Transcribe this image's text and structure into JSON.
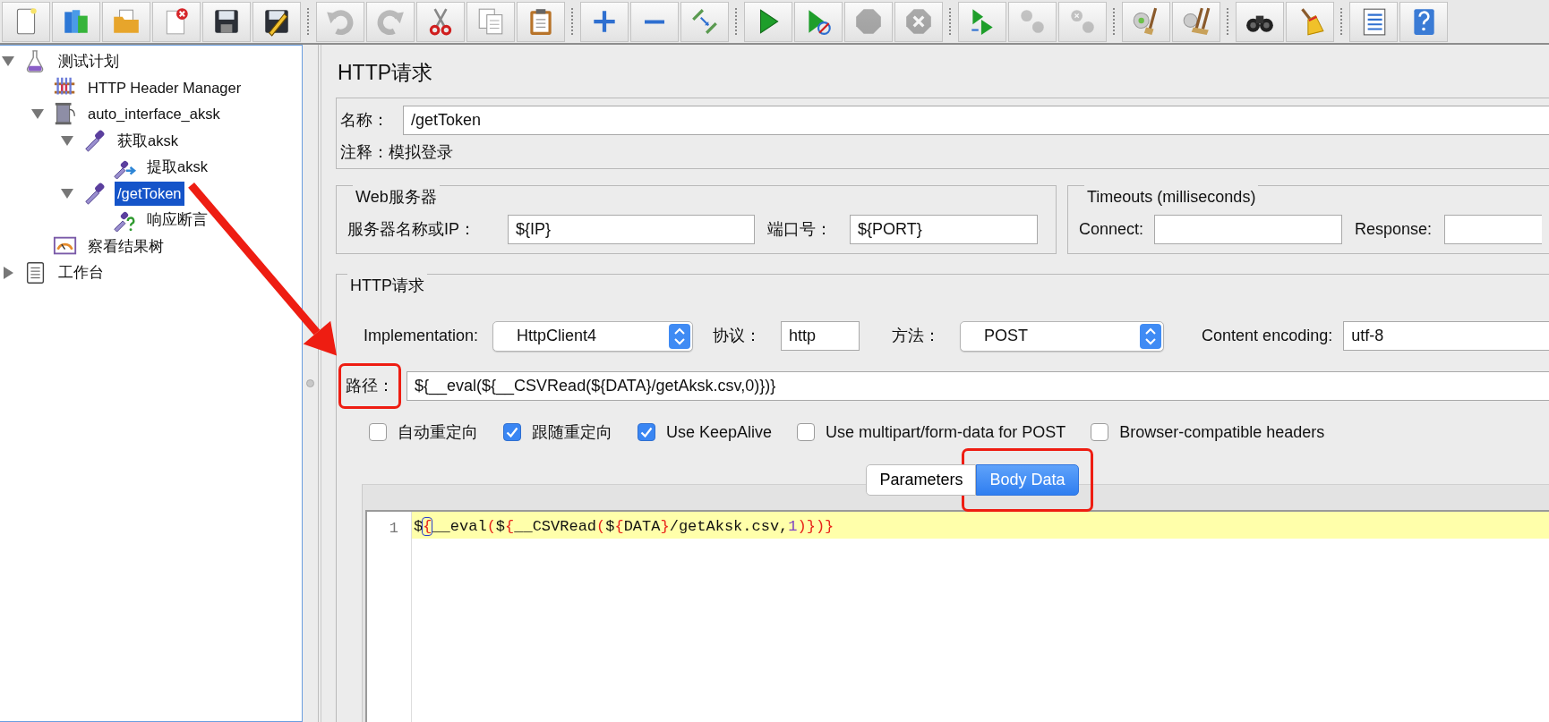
{
  "toolbar": {
    "groups": [
      [
        {
          "disabled": false
        },
        {
          "disabled": false
        },
        {
          "disabled": false
        },
        {
          "disabled": false
        },
        {
          "disabled": false
        },
        {
          "disabled": false
        }
      ],
      [
        {
          "disabled": true
        },
        {
          "disabled": true
        },
        {
          "disabled": false
        },
        {
          "disabled": false
        },
        {
          "disabled": false
        }
      ],
      [
        {
          "disabled": false
        },
        {
          "disabled": false
        },
        {
          "disabled": false
        }
      ],
      [
        {
          "disabled": false
        },
        {
          "disabled": false
        },
        {
          "disabled": true
        },
        {
          "disabled": true
        }
      ],
      [
        {
          "disabled": false
        },
        {
          "disabled": true
        },
        {
          "disabled": true
        }
      ],
      [
        {
          "disabled": false
        },
        {
          "disabled": false
        }
      ],
      [
        {
          "disabled": false
        },
        {
          "disabled": false
        }
      ],
      [
        {
          "disabled": false
        },
        {
          "disabled": false
        }
      ]
    ]
  },
  "tree": [
    {
      "label": "测试计划",
      "kind": "test-plan",
      "expanded": true,
      "selected": false,
      "children": [
        {
          "label": "HTTP Header Manager",
          "kind": "config-element",
          "selected": false
        },
        {
          "label": "auto_interface_aksk",
          "kind": "thread-group",
          "expanded": true,
          "selected": false,
          "children": [
            {
              "label": "获取aksk",
              "kind": "sampler",
              "expanded": true,
              "selected": false,
              "children": [
                {
                  "label": "提取aksk",
                  "kind": "post-processor",
                  "selected": false
                }
              ]
            },
            {
              "label": "/getToken",
              "kind": "sampler",
              "expanded": true,
              "selected": true,
              "children": [
                {
                  "label": "响应断言",
                  "kind": "assertion",
                  "selected": false
                }
              ]
            }
          ]
        },
        {
          "label": "察看结果树",
          "kind": "listener",
          "selected": false
        }
      ]
    },
    {
      "label": "工作台",
      "kind": "workbench",
      "expanded": false,
      "selected": false
    }
  ],
  "form": {
    "title": "HTTP请求",
    "name": {
      "label": "名称：",
      "value": "/getToken"
    },
    "comment": {
      "label": "注释：",
      "value": "模拟登录"
    },
    "web_server": {
      "legend": "Web服务器",
      "fields": [
        {
          "label": "服务器名称或IP：",
          "value": "${IP}"
        },
        {
          "label": "端口号：",
          "value": "${PORT}"
        }
      ]
    },
    "timeouts": {
      "legend": "Timeouts (milliseconds)",
      "fields": [
        {
          "label": "Connect:"
        },
        {
          "label": "Response:"
        }
      ]
    },
    "http_request": {
      "legend": "HTTP请求",
      "implementation": {
        "label": "Implementation:",
        "value": "HttpClient4"
      },
      "protocol": {
        "label": "协议：",
        "value": "http"
      },
      "method": {
        "label": "方法：",
        "value": "POST"
      },
      "content_encoding": {
        "label": "Content encoding:",
        "value": "utf-8"
      },
      "path": {
        "label": "路径：",
        "value": "${__eval(${__CSVRead(${DATA}/getAksk.csv,0)})}"
      },
      "options": [
        {
          "label": "自动重定向",
          "checked": false
        },
        {
          "label": "跟随重定向",
          "checked": true
        },
        {
          "label": "Use KeepAlive",
          "checked": true
        },
        {
          "label": "Use multipart/form-data for POST",
          "checked": false
        },
        {
          "label": "Browser-compatible headers",
          "checked": false
        }
      ],
      "tabs": [
        {
          "label": "Parameters",
          "selected": false
        },
        {
          "label": "Body Data",
          "selected": true
        }
      ],
      "body": {
        "lines": [
          {
            "number": "1",
            "current": true,
            "tokens": [
              {
                "text": "$",
                "kind": "plain"
              },
              {
                "text": "{",
                "kind": "brace-matched"
              },
              {
                "text": "__eval",
                "kind": "plain"
              },
              {
                "text": "(",
                "kind": "brace"
              },
              {
                "text": "$",
                "kind": "plain"
              },
              {
                "text": "{",
                "kind": "brace"
              },
              {
                "text": "__CSVRead",
                "kind": "plain"
              },
              {
                "text": "(",
                "kind": "brace"
              },
              {
                "text": "$",
                "kind": "plain"
              },
              {
                "text": "{",
                "kind": "brace"
              },
              {
                "text": "DATA",
                "kind": "plain"
              },
              {
                "text": "}",
                "kind": "brace"
              },
              {
                "text": "/getAksk.csv,",
                "kind": "plain"
              },
              {
                "text": "1",
                "kind": "number"
              },
              {
                "text": ")})}",
                "kind": "brace"
              }
            ]
          }
        ]
      }
    }
  }
}
